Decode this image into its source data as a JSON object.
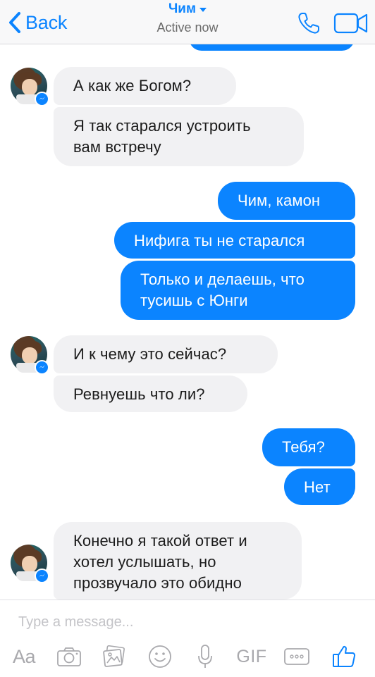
{
  "header": {
    "back_label": "Back",
    "contact_name": "Чим",
    "status": "Active now",
    "icons": [
      "back-chevron-icon",
      "caret-down-icon",
      "phone-icon",
      "video-camera-icon"
    ]
  },
  "messages": [
    {
      "side": "in",
      "text": "А как же Богом?"
    },
    {
      "side": "in",
      "text": "Я так старался устроить\nвам встречу"
    },
    {
      "side": "out",
      "text": "Чим, камон"
    },
    {
      "side": "out",
      "text": "Нифига ты не старался"
    },
    {
      "side": "out",
      "text": "Только и делаешь, что\nтусишь с Юнги"
    },
    {
      "side": "in",
      "text": "И к чему это сейчас?"
    },
    {
      "side": "in",
      "text": "Ревнуешь что ли?"
    },
    {
      "side": "out",
      "text": "Тебя?"
    },
    {
      "side": "out",
      "text": "Нет"
    },
    {
      "side": "in",
      "text": "Конечно я такой ответ и\nхотел услышать, но\nпрозвучало это обидно"
    }
  ],
  "composer": {
    "placeholder": "Type a message...",
    "text_format_label": "Aa",
    "gif_label": "GIF",
    "icons": [
      "camera-icon",
      "gallery-icon",
      "emoji-icon",
      "microphone-icon",
      "more-icon",
      "thumbs-up-icon"
    ]
  },
  "colors": {
    "accent": "#0b84ff",
    "incoming_bubble": "#f1f1f3",
    "header_bg": "#f8f8f9",
    "muted_icon": "#a9a9ad"
  }
}
